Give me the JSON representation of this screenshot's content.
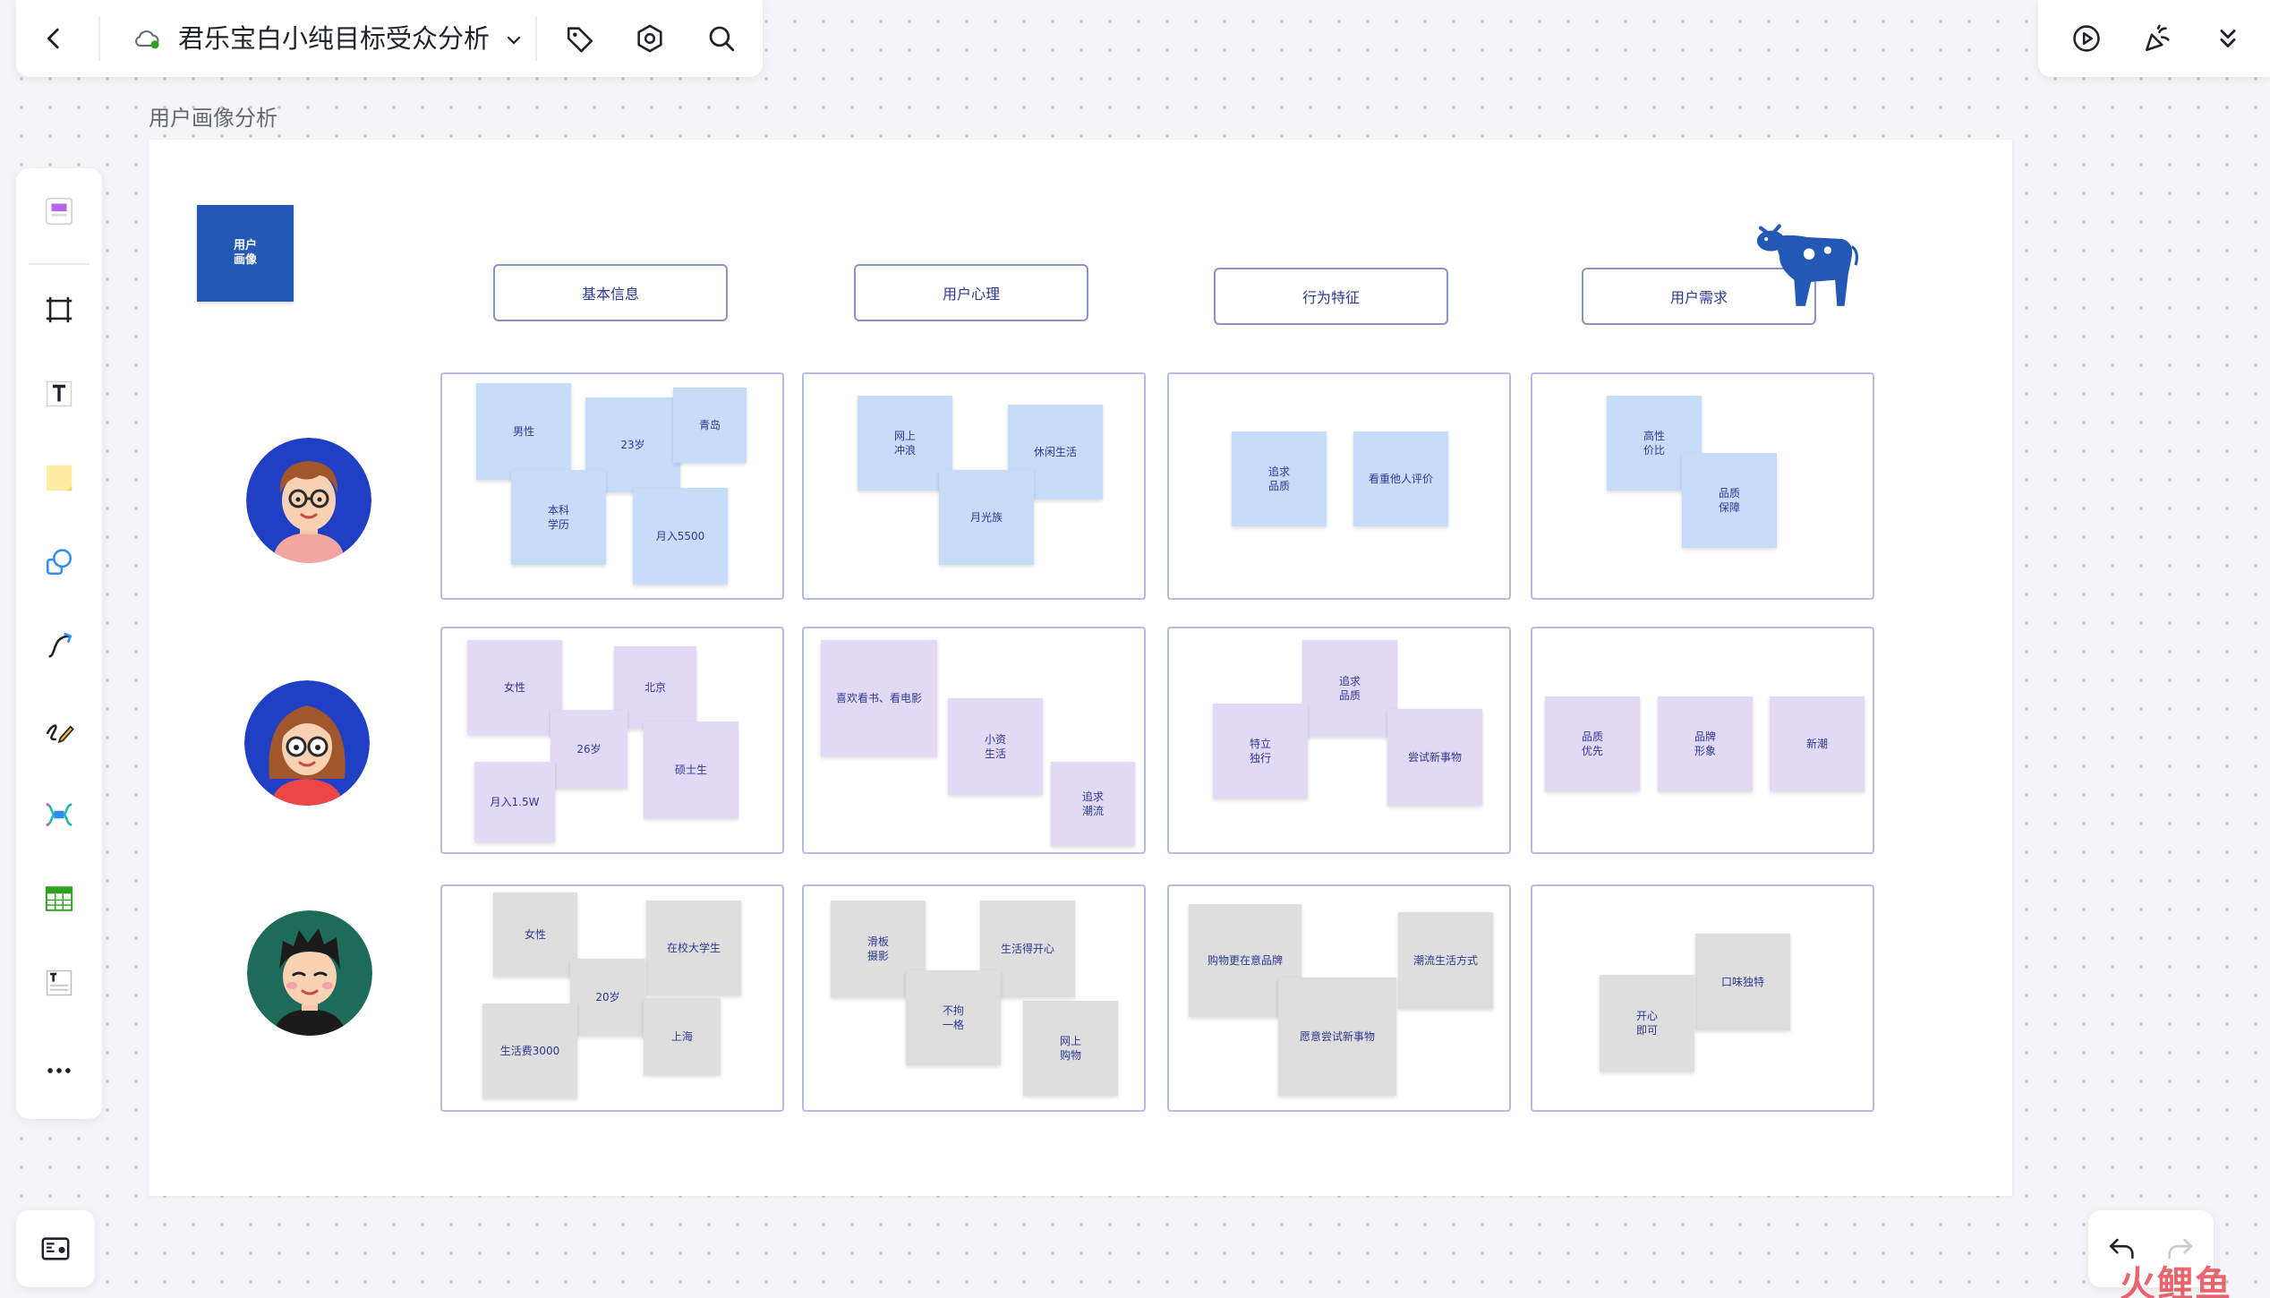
{
  "header": {
    "doc_title": "君乐宝白小纯目标受众分析"
  },
  "frame": {
    "label": "用户画像分析"
  },
  "board": {
    "title_block": "用户\n画像",
    "headers": [
      "基本信息",
      "用户心理",
      "行为特征",
      "用户需求"
    ],
    "rows": [
      [
        [
          "男性",
          "23岁",
          "青岛",
          "本科\n学历",
          "月入5500"
        ],
        [
          "网上\n冲浪",
          "休闲生活",
          "月光族"
        ],
        [
          "追求\n品质",
          "看重他人评价"
        ],
        [
          "高性\n价比",
          "品质\n保障"
        ]
      ],
      [
        [
          "女性",
          "北京",
          "26岁",
          "硕士生",
          "月入1.5W"
        ],
        [
          "喜欢看书、看电影",
          "小资\n生活",
          "追求\n潮流"
        ],
        [
          "追求\n品质",
          "特立\n独行",
          "尝试新事物"
        ],
        [
          "品质\n优先",
          "品牌\n形象",
          "新潮"
        ]
      ],
      [
        [
          "女性",
          "在校大学生",
          "20岁",
          "上海",
          "生活费3000"
        ],
        [
          "滑板\n摄影",
          "生活得开心",
          "不拘\n一格",
          "网上\n购物"
        ],
        [
          "购物更在意品牌",
          "潮流生活方式",
          "愿意尝试新事物"
        ],
        [
          "口味独特",
          "开心\n即可"
        ]
      ]
    ]
  },
  "watermark": "火鲤鱼",
  "colors": {
    "accent_blue": "#2359b4",
    "sticky_blue": "#c6dcf9",
    "sticky_purple": "#e2d9f4",
    "sticky_gray": "#dedede"
  }
}
